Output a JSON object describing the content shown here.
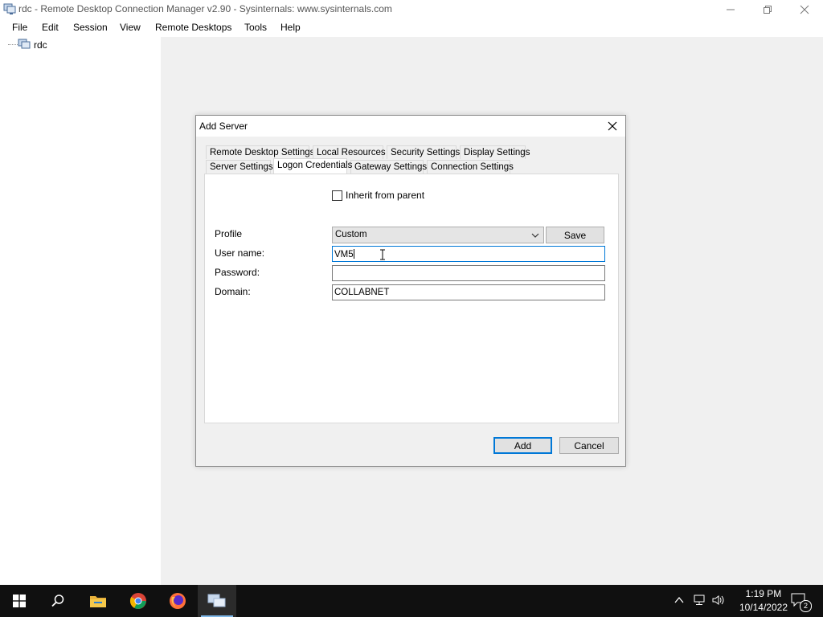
{
  "window": {
    "title": "rdc - Remote Desktop Connection Manager v2.90 - Sysinternals: www.sysinternals.com"
  },
  "menu": [
    "File",
    "Edit",
    "Session",
    "View",
    "Remote Desktops",
    "Tools",
    "Help"
  ],
  "tree": {
    "root_label": "rdc"
  },
  "dialog": {
    "title": "Add Server",
    "tabs_row1": [
      "Remote Desktop Settings",
      "Local Resources",
      "Security Settings",
      "Display Settings"
    ],
    "tabs_row2": [
      "Server Settings",
      "Logon Credentials",
      "Gateway Settings",
      "Connection Settings"
    ],
    "active_tab": "Logon Credentials",
    "inherit_label": "Inherit from parent",
    "inherit_checked": false,
    "profile_label": "Profile",
    "profile_value": "Custom",
    "save_label": "Save",
    "username_label": "User name:",
    "username_value": "VM5",
    "password_label": "Password:",
    "password_value": "",
    "domain_label": "Domain:",
    "domain_value": "COLLABNET",
    "add_label": "Add",
    "cancel_label": "Cancel"
  },
  "taskbar": {
    "time": "1:19 PM",
    "date": "10/14/2022",
    "notification_count": "2"
  },
  "colors": {
    "accent": "#0078d7",
    "taskbar": "#101010",
    "workspace": "#f0f0f0"
  }
}
